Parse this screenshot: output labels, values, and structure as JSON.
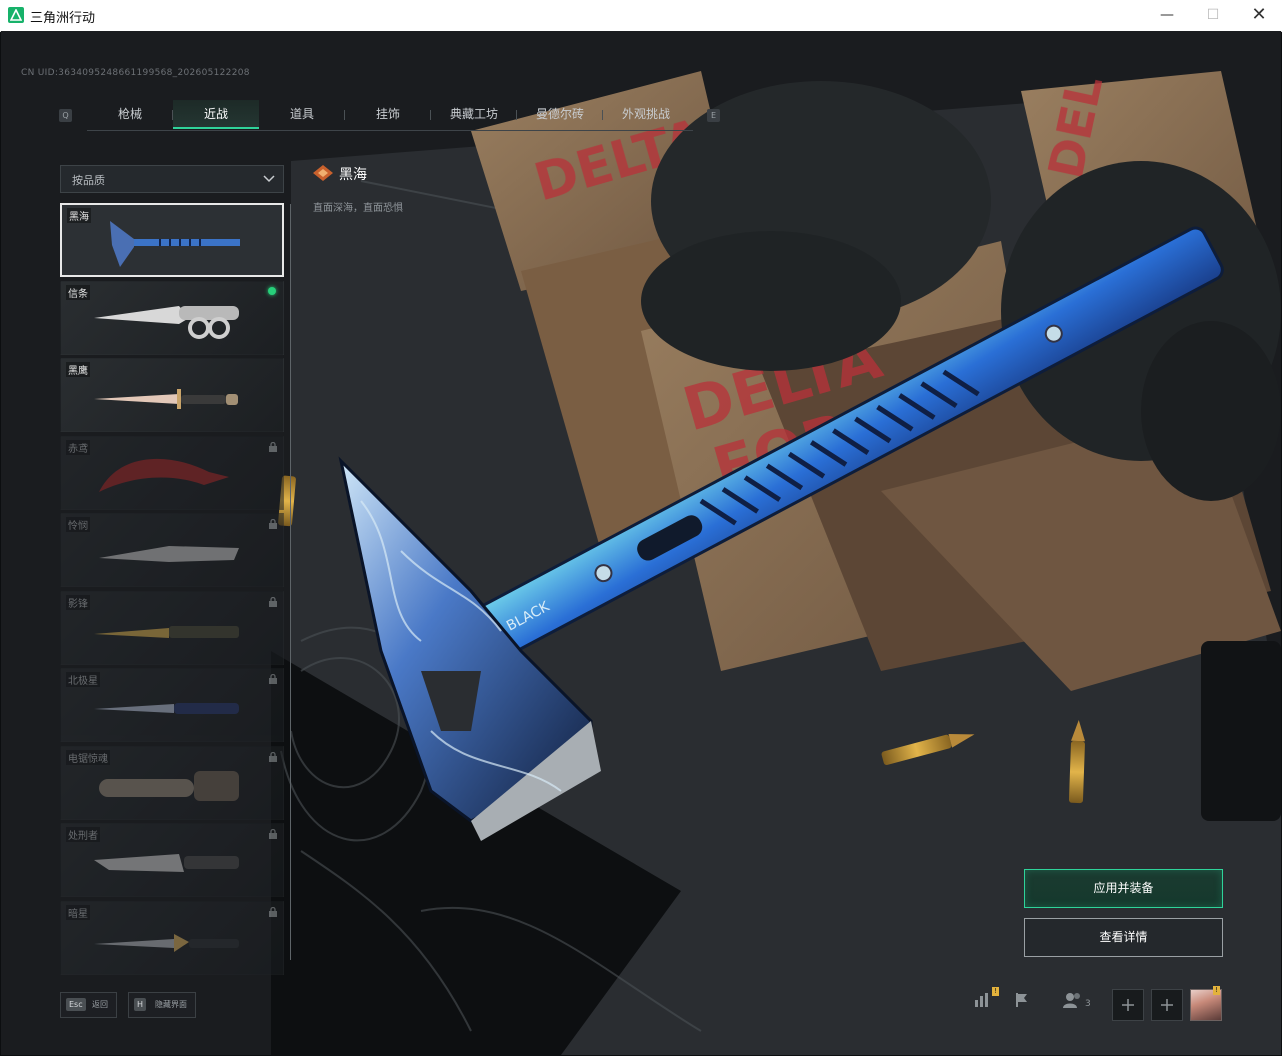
{
  "window": {
    "title": "三角洲行动",
    "min_glyph": "—",
    "max_glyph": "☐",
    "close_glyph": "✕"
  },
  "uid_text": "CN UID:3634095248661199568_202605122208",
  "tabbar": {
    "left_key": "Q",
    "right_key": "E",
    "tabs": [
      {
        "label": "枪械",
        "active": false
      },
      {
        "label": "近战",
        "active": true
      },
      {
        "label": "道具",
        "active": false
      },
      {
        "label": "挂饰",
        "active": false
      },
      {
        "label": "典藏工坊",
        "active": false
      },
      {
        "label": "曼德尔砖",
        "active": false
      },
      {
        "label": "外观挑战",
        "active": false
      }
    ]
  },
  "filter": {
    "label": "按品质"
  },
  "items": [
    {
      "name": "黑海",
      "selected": true,
      "equipped": false,
      "locked": false,
      "icon": "tomahawk-icon"
    },
    {
      "name": "信条",
      "selected": false,
      "equipped": true,
      "locked": false,
      "icon": "knuckle-knife-icon"
    },
    {
      "name": "黑鹰",
      "selected": false,
      "equipped": false,
      "locked": false,
      "icon": "combat-knife-icon"
    },
    {
      "name": "赤鸢",
      "selected": false,
      "equipped": false,
      "locked": true,
      "icon": "karambit-icon"
    },
    {
      "name": "怜悯",
      "selected": false,
      "equipped": false,
      "locked": true,
      "icon": "folding-knife-icon"
    },
    {
      "name": "影锋",
      "selected": false,
      "equipped": false,
      "locked": true,
      "icon": "dagger-icon"
    },
    {
      "name": "北极星",
      "selected": false,
      "equipped": false,
      "locked": true,
      "icon": "tactical-knife-icon"
    },
    {
      "name": "电锯惊魂",
      "selected": false,
      "equipped": false,
      "locked": true,
      "icon": "chainsaw-icon"
    },
    {
      "name": "处刑者",
      "selected": false,
      "equipped": false,
      "locked": true,
      "icon": "bowie-knife-icon"
    },
    {
      "name": "暗星",
      "selected": false,
      "equipped": false,
      "locked": true,
      "icon": "blade-icon"
    }
  ],
  "selected_item": {
    "name": "黑海",
    "description": "直面深海，直面恐惧"
  },
  "buttons": {
    "apply": "应用并装备",
    "detail": "查看详情"
  },
  "bottom": {
    "back_key": "Esc",
    "back_label": "返回",
    "hide_key": "H",
    "hide_label": "隐藏界面",
    "stats_badge": "!",
    "friends_count": "3",
    "avatar_badge": "!"
  },
  "colors": {
    "accent": "#2fd39a",
    "equipped": "#27d07a",
    "blade_blue": "#2a6fd6"
  }
}
